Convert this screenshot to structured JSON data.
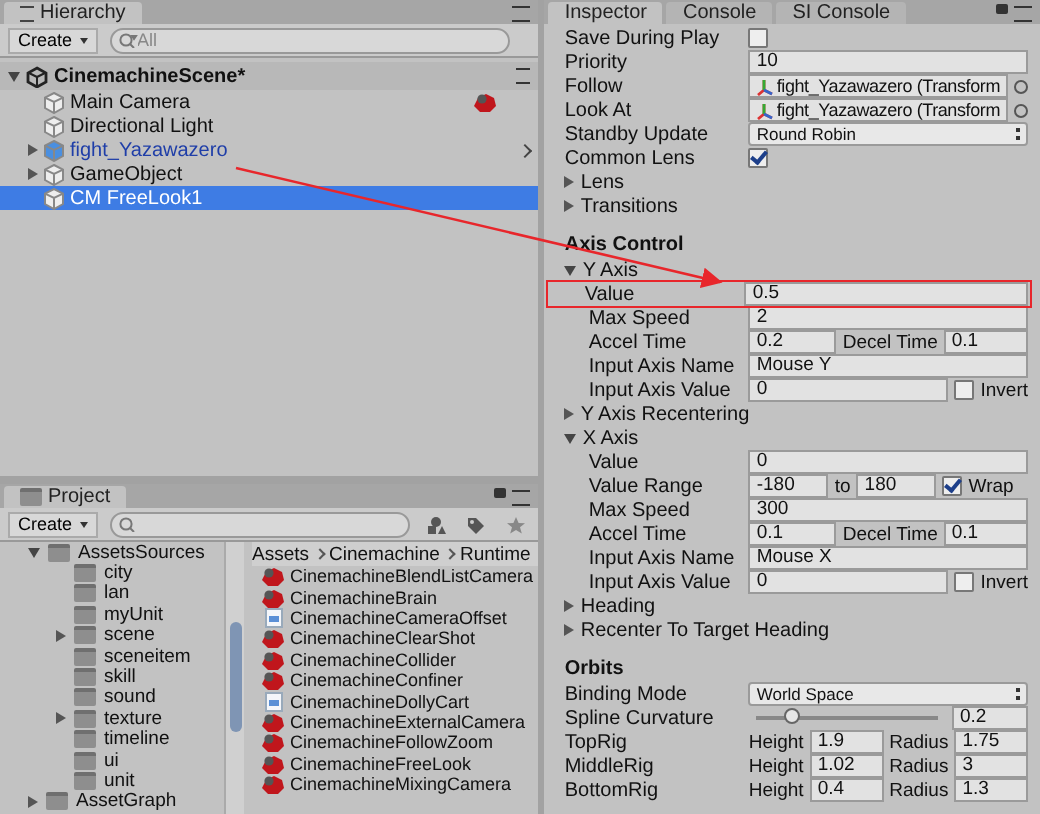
{
  "hierarchy": {
    "tab": "Hierarchy",
    "create": "Create",
    "search": {
      "placeholder": "All"
    },
    "scene": {
      "label": "CinemachineScene*",
      "expanded": true,
      "children": [
        {
          "label": "Main Camera",
          "kind": "gameobject",
          "component_icon": true,
          "selected": false
        },
        {
          "label": "Directional Light",
          "kind": "gameobject",
          "selected": false
        },
        {
          "label": "fight_Yazawazero",
          "kind": "prefab",
          "expanded": false,
          "selected": false
        },
        {
          "label": "GameObject",
          "kind": "gameobject",
          "expanded": false,
          "selected": false
        },
        {
          "label": "CM FreeLook1",
          "kind": "gameobject",
          "selected": true
        }
      ]
    }
  },
  "project": {
    "tab": "Project",
    "create": "Create",
    "folders": [
      {
        "label": "AssetsSources",
        "expanded": true,
        "children": [
          {
            "label": "city"
          },
          {
            "label": "lan"
          },
          {
            "label": "myUnit"
          },
          {
            "label": "scene",
            "expanded": false
          },
          {
            "label": "sceneitem"
          },
          {
            "label": "skill"
          },
          {
            "label": "sound"
          },
          {
            "label": "texture",
            "expanded": false
          },
          {
            "label": "timeline"
          },
          {
            "label": "ui"
          },
          {
            "label": "unit"
          }
        ]
      },
      {
        "label": "AssetGraph",
        "expanded": false
      }
    ],
    "breadcrumb": [
      "Assets",
      "Cinemachine",
      "Runtime"
    ],
    "files": [
      {
        "label": "CinemachineBlendListCamera",
        "kind": "component"
      },
      {
        "label": "CinemachineBrain",
        "kind": "component"
      },
      {
        "label": "CinemachineCameraOffset",
        "kind": "script"
      },
      {
        "label": "CinemachineClearShot",
        "kind": "component"
      },
      {
        "label": "CinemachineCollider",
        "kind": "component"
      },
      {
        "label": "CinemachineConfiner",
        "kind": "component"
      },
      {
        "label": "CinemachineDollyCart",
        "kind": "script"
      },
      {
        "label": "CinemachineExternalCamera",
        "kind": "component"
      },
      {
        "label": "CinemachineFollowZoom",
        "kind": "component"
      },
      {
        "label": "CinemachineFreeLook",
        "kind": "component"
      },
      {
        "label": "CinemachineMixingCamera",
        "kind": "component"
      }
    ]
  },
  "inspector": {
    "tabs": [
      {
        "label": "Inspector",
        "selected": true
      },
      {
        "label": "Console",
        "selected": false
      },
      {
        "label": "SI Console",
        "selected": false
      }
    ],
    "rows": [
      {
        "kind": "toggle",
        "label": "Save During Play",
        "checked": false
      },
      {
        "kind": "field",
        "label": "Priority",
        "value": "10"
      },
      {
        "kind": "object",
        "label": "Follow",
        "value": "fight_Yazawazero (Transform"
      },
      {
        "kind": "object",
        "label": "Look At",
        "value": "fight_Yazawazero (Transform"
      },
      {
        "kind": "dropdown",
        "label": "Standby Update",
        "value": "Round Robin"
      },
      {
        "kind": "toggle",
        "label": "Common Lens",
        "checked": true
      },
      {
        "kind": "foldout",
        "label": "Lens",
        "expanded": false
      },
      {
        "kind": "foldout",
        "label": "Transitions",
        "expanded": false
      },
      {
        "kind": "header",
        "label": "Axis Control"
      },
      {
        "kind": "foldout",
        "label": "Y Axis",
        "expanded": true,
        "children": [
          {
            "kind": "field",
            "label": "Value",
            "value": "0.5",
            "highlighted": true
          },
          {
            "kind": "field",
            "label": "Max Speed",
            "value": "2"
          },
          {
            "kind": "pair",
            "label": "Accel Time",
            "value": "0.2",
            "label2": "Decel Time",
            "value2": "0.1"
          },
          {
            "kind": "field",
            "label": "Input Axis Name",
            "value": "Mouse Y"
          },
          {
            "kind": "field-toggle",
            "label": "Input Axis Value",
            "value": "0",
            "toggle_label": "Invert",
            "checked": false
          }
        ]
      },
      {
        "kind": "foldout",
        "label": "Y Axis Recentering",
        "expanded": false
      },
      {
        "kind": "foldout",
        "label": "X Axis",
        "expanded": true,
        "children": [
          {
            "kind": "field",
            "label": "Value",
            "value": "0"
          },
          {
            "kind": "range",
            "label": "Value Range",
            "value": "-180",
            "separator": "to",
            "value2": "180",
            "toggle_label": "Wrap",
            "checked": true
          },
          {
            "kind": "field",
            "label": "Max Speed",
            "value": "300"
          },
          {
            "kind": "pair",
            "label": "Accel Time",
            "value": "0.1",
            "label2": "Decel Time",
            "value2": "0.1"
          },
          {
            "kind": "field",
            "label": "Input Axis Name",
            "value": "Mouse X"
          },
          {
            "kind": "field-toggle",
            "label": "Input Axis Value",
            "value": "0",
            "toggle_label": "Invert",
            "checked": false
          }
        ]
      },
      {
        "kind": "foldout",
        "label": "Heading",
        "expanded": false
      },
      {
        "kind": "foldout",
        "label": "Recenter To Target Heading",
        "expanded": false
      },
      {
        "kind": "header",
        "label": "Orbits"
      },
      {
        "kind": "dropdown",
        "label": "Binding Mode",
        "value": "World Space"
      },
      {
        "kind": "slider",
        "label": "Spline Curvature",
        "level": 0.2,
        "value": "0.2"
      },
      {
        "kind": "rig",
        "label": "TopRig",
        "label2": "Height",
        "value": "1.9",
        "label3": "Radius",
        "value2": "1.75"
      },
      {
        "kind": "rig",
        "label": "MiddleRig",
        "label2": "Height",
        "value": "1.02",
        "label3": "Radius",
        "value2": "3"
      },
      {
        "kind": "rig",
        "label": "BottomRig",
        "label2": "Height",
        "value": "0.4",
        "label3": "Radius",
        "value2": "1.3"
      }
    ]
  }
}
